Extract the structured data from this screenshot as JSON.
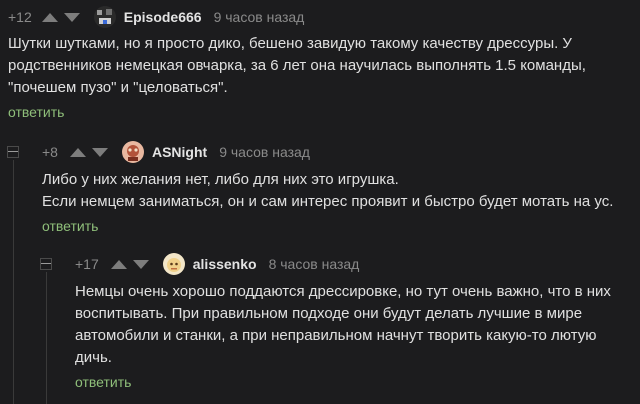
{
  "comments": [
    {
      "rating": "+12",
      "author": "Episode666",
      "time": "9 часов назад",
      "text": "Шутки шутками, но я просто дико, бешено завидую такому качеству дрессуры. У родственников немецкая овчарка, за 6 лет она научилась выполнять 1.5 команды, \"почешем пузо\" и \"целоваться\".",
      "reply": "ответить"
    },
    {
      "rating": "+8",
      "author": "ASNight",
      "time": "9 часов назад",
      "text_lines": [
        "Либо у них желания нет, либо для  них это игрушка.",
        "Если немцем заниматься, он и сам интерес проявит и быстро будет мотать на ус."
      ],
      "reply": "ответить"
    },
    {
      "rating": "+17",
      "author": "alissenko",
      "time": "8 часов назад",
      "text": "Немцы очень хорошо поддаются дрессировке, но тут очень важно, что в них воспитывать. При правильном подходе они будут делать лучшие в мире автомобили и станки, а при неправильном начнут творить какую-то лютую дичь.",
      "reply": "ответить"
    }
  ],
  "colors": {
    "background": "#1c1c1e",
    "reply_link": "#8fbf7a",
    "meta_text": "#8a8a8a",
    "author": "#e3e3e3"
  }
}
